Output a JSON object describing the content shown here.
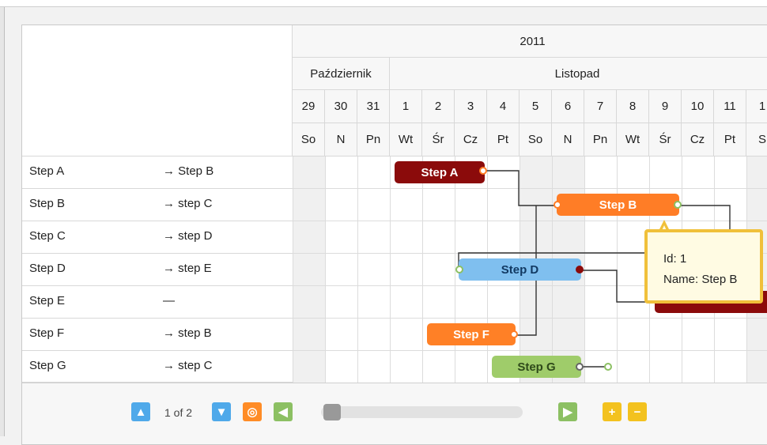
{
  "header": {
    "year": "2011",
    "months": [
      "Październik",
      "Listopad"
    ],
    "days": [
      "29",
      "30",
      "31",
      "1",
      "2",
      "3",
      "4",
      "5",
      "6",
      "7",
      "8",
      "9",
      "10",
      "11",
      "1"
    ],
    "weekdays": [
      "So",
      "N",
      "Pn",
      "Wt",
      "Śr",
      "Cz",
      "Pt",
      "So",
      "N",
      "Pn",
      "Wt",
      "Śr",
      "Cz",
      "Pt",
      "S"
    ]
  },
  "rows": [
    {
      "name": "Step A",
      "dep": "→ Step B"
    },
    {
      "name": "Step B",
      "dep": "→ step C"
    },
    {
      "name": "Step C",
      "dep": "→ step D"
    },
    {
      "name": "Step D",
      "dep": "→ step E"
    },
    {
      "name": "Step E",
      "dep": "—"
    },
    {
      "name": "Step F",
      "dep": "→ step B"
    },
    {
      "name": "Step G",
      "dep": "→ step C"
    }
  ],
  "bars": {
    "step_a": "Step A",
    "step_b": "Step B",
    "step_d": "Step D",
    "step_f": "Step F",
    "step_g": "Step G"
  },
  "tooltip": {
    "id_line": "Id: 1",
    "name_line": "Name: Step B"
  },
  "footer": {
    "page_info": "1 of 2"
  },
  "colors": {
    "step_a": "#8b0b0b",
    "step_b": "#ff7d26",
    "step_d": "#7fbfef",
    "step_f": "#ff8026",
    "step_g": "#9fcc6a",
    "tooltip_border": "#f0c03a"
  }
}
